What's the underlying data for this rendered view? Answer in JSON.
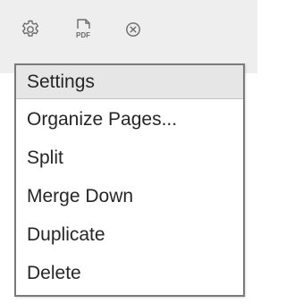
{
  "toolbar": {
    "icons": [
      {
        "name": "gear-icon"
      },
      {
        "name": "pdf-file-icon",
        "text": "PDF"
      },
      {
        "name": "close-circle-icon"
      }
    ]
  },
  "menu": {
    "selected_index": 0,
    "items": [
      {
        "label": "Settings"
      },
      {
        "label": "Organize Pages..."
      },
      {
        "label": "Split"
      },
      {
        "label": "Merge Down"
      },
      {
        "label": "Duplicate"
      },
      {
        "label": "Delete"
      }
    ]
  },
  "colors": {
    "toolbar_bg": "#eeeeee",
    "menu_bg": "#ffffff",
    "menu_border": "#7a7a7a",
    "selected_bg": "#e6e6e6",
    "text": "#262626",
    "icon": "#6b6b6b"
  }
}
